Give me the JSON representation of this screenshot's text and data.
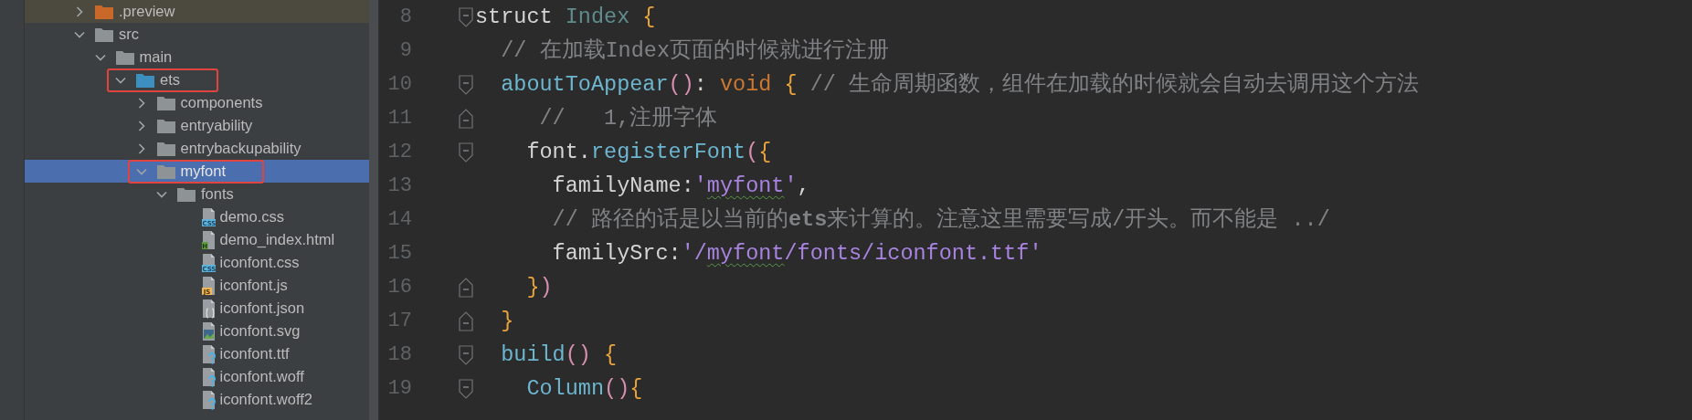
{
  "project_tree": {
    "items": [
      {
        "name": ".preview",
        "kind": "folder",
        "color": "#c8692a",
        "expanded": false,
        "selected": false,
        "highlighted": true
      },
      {
        "name": "src",
        "kind": "folder",
        "color": "#8e9396",
        "expanded": true,
        "selected": false,
        "children": [
          {
            "name": "main",
            "kind": "folder",
            "color": "#8e9396",
            "expanded": true,
            "selected": false,
            "children": [
              {
                "name": "ets",
                "kind": "folder",
                "color": "#3d8fc0",
                "expanded": true,
                "selected": false,
                "annotated": true,
                "children": [
                  {
                    "name": "components",
                    "kind": "folder",
                    "color": "#8e9396",
                    "expanded": false,
                    "selected": false
                  },
                  {
                    "name": "entryability",
                    "kind": "folder",
                    "color": "#8e9396",
                    "expanded": false,
                    "selected": false
                  },
                  {
                    "name": "entrybackupability",
                    "kind": "folder",
                    "color": "#8e9396",
                    "expanded": false,
                    "selected": false
                  },
                  {
                    "name": "myfont",
                    "kind": "folder",
                    "color": "#8e9396",
                    "expanded": true,
                    "selected": true,
                    "annotated": true,
                    "children": [
                      {
                        "name": "fonts",
                        "kind": "folder",
                        "color": "#8e9396",
                        "expanded": true,
                        "selected": false,
                        "children": [
                          {
                            "name": "demo.css",
                            "kind": "css",
                            "badge": "CSS",
                            "selected": false
                          },
                          {
                            "name": "demo_index.html",
                            "kind": "html",
                            "badge": "H",
                            "selected": false
                          },
                          {
                            "name": "iconfont.css",
                            "kind": "css",
                            "badge": "CSS",
                            "selected": false
                          },
                          {
                            "name": "iconfont.js",
                            "kind": "js",
                            "badge": "JS",
                            "selected": false
                          },
                          {
                            "name": "iconfont.json",
                            "kind": "json",
                            "selected": false
                          },
                          {
                            "name": "iconfont.svg",
                            "kind": "image",
                            "selected": false
                          },
                          {
                            "name": "iconfont.ttf",
                            "kind": "unknown",
                            "selected": false
                          },
                          {
                            "name": "iconfont.woff",
                            "kind": "unknown",
                            "selected": false
                          },
                          {
                            "name": "iconfont.woff2",
                            "kind": "unknown",
                            "selected": false
                          }
                        ]
                      }
                    ]
                  }
                ]
              }
            ]
          }
        ]
      }
    ]
  },
  "editor": {
    "lines": [
      {
        "number": "8",
        "kind": "fold_start",
        "tokens": [
          {
            "text": "struct ",
            "kind": "plain"
          },
          {
            "text": "Index ",
            "kind": "type"
          },
          {
            "text": "{",
            "kind": "brace"
          }
        ]
      },
      {
        "number": "9",
        "tokens": [
          {
            "text": "  // 在加载Index页面的时候就进行注册",
            "kind": "comment"
          }
        ]
      },
      {
        "number": "10",
        "kind": "fold_start",
        "tokens": [
          {
            "text": "  aboutToAppear",
            "kind": "func"
          },
          {
            "text": "()",
            "kind": "paren"
          },
          {
            "text": ": ",
            "kind": "plain"
          },
          {
            "text": "void ",
            "kind": "keyword"
          },
          {
            "text": "{ ",
            "kind": "brace"
          },
          {
            "text": "// 生命周期函数，组件在加载的时候就会自动去调用这个方法",
            "kind": "comment"
          }
        ]
      },
      {
        "number": "11",
        "kind": "fold_end",
        "tokens": [
          {
            "text": "     //   1,注册字体",
            "kind": "comment"
          }
        ]
      },
      {
        "number": "12",
        "kind": "fold_start",
        "tokens": [
          {
            "text": "    font.",
            "kind": "plain"
          },
          {
            "text": "registerFont",
            "kind": "func"
          },
          {
            "text": "(",
            "kind": "paren"
          },
          {
            "text": "{",
            "kind": "brace"
          }
        ]
      },
      {
        "number": "13",
        "tokens": [
          {
            "text": "      familyName:",
            "kind": "plain"
          },
          {
            "text": "'",
            "kind": "string"
          },
          {
            "text": "myfont",
            "kind": "string",
            "typo": true
          },
          {
            "text": "'",
            "kind": "string"
          },
          {
            "text": ",",
            "kind": "plain"
          }
        ]
      },
      {
        "number": "14",
        "tokens": [
          {
            "text": "      // 路径的话是以当前的**ets**来计算的。注意这里需要写成/开头。而不能是 ../",
            "kind": "comment"
          }
        ]
      },
      {
        "number": "15",
        "tokens": [
          {
            "text": "      familySrc:",
            "kind": "plain"
          },
          {
            "text": "'/",
            "kind": "string"
          },
          {
            "text": "myfont",
            "kind": "string",
            "typo": true
          },
          {
            "text": "/fonts/iconfont.ttf'",
            "kind": "string"
          }
        ]
      },
      {
        "number": "16",
        "kind": "fold_end",
        "tokens": [
          {
            "text": "    }",
            "kind": "brace"
          },
          {
            "text": ")",
            "kind": "paren"
          }
        ]
      },
      {
        "number": "17",
        "kind": "fold_end",
        "tokens": [
          {
            "text": "  }",
            "kind": "brace"
          }
        ]
      },
      {
        "number": "18",
        "kind": "fold_start",
        "tokens": [
          {
            "text": "  build",
            "kind": "func"
          },
          {
            "text": "() ",
            "kind": "paren"
          },
          {
            "text": "{",
            "kind": "brace"
          }
        ]
      },
      {
        "number": "19",
        "kind": "fold_start",
        "tokens": [
          {
            "text": "    Column",
            "kind": "func"
          },
          {
            "text": "()",
            "kind": "paren"
          },
          {
            "text": "{",
            "kind": "brace"
          }
        ]
      }
    ]
  }
}
